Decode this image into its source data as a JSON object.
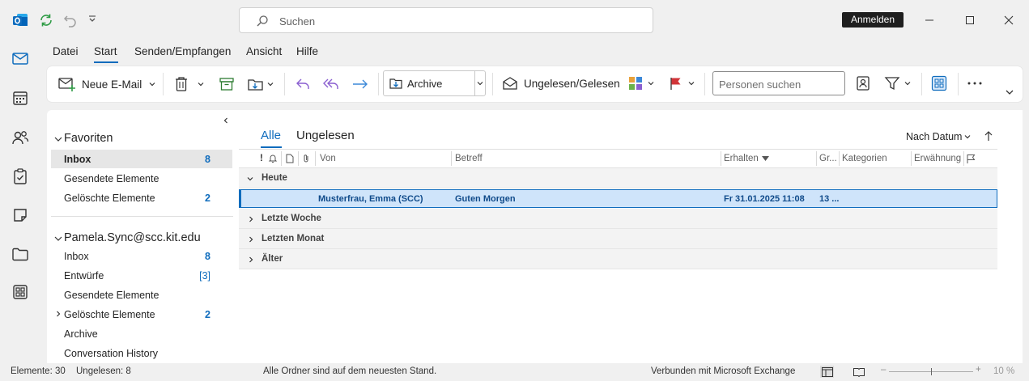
{
  "titlebar": {
    "search_placeholder": "Suchen",
    "signin_label": "Anmelden"
  },
  "menu": {
    "items": [
      "Datei",
      "Start",
      "Senden/Empfangen",
      "Ansicht",
      "Hilfe"
    ]
  },
  "ribbon": {
    "new_mail": "Neue E-Mail",
    "archive": "Archive",
    "unread_read": "Ungelesen/Gelesen",
    "persons_placeholder": "Personen suchen"
  },
  "folders": {
    "favorites_header": "Favoriten",
    "favorites": [
      {
        "label": "Inbox",
        "count": "8"
      },
      {
        "label": "Gesendete Elemente",
        "count": ""
      },
      {
        "label": "Gelöschte Elemente",
        "count": "2"
      }
    ],
    "account_header": "Pamela.Sync@scc.kit.edu",
    "account_items": [
      {
        "label": "Inbox",
        "count": "8"
      },
      {
        "label": "Entwürfe",
        "count": "[3]"
      },
      {
        "label": "Gesendete Elemente",
        "count": ""
      },
      {
        "label": "Gelöschte Elemente",
        "count": "2"
      },
      {
        "label": "Archive",
        "count": ""
      },
      {
        "label": "Conversation History",
        "count": ""
      }
    ]
  },
  "mail": {
    "tabs": [
      "Alle",
      "Ungelesen"
    ],
    "sort_label": "Nach Datum",
    "columns": {
      "flag": "!",
      "from": "Von",
      "subject": "Betreff",
      "received": "Erhalten",
      "size": "Gr...",
      "categories": "Kategorien",
      "mention": "Erwähnung"
    },
    "groups": [
      "Heute",
      "Letzte Woche",
      "Letzten Monat",
      "Älter"
    ],
    "message": {
      "from": "Musterfrau, Emma (SCC)",
      "subject": "Guten Morgen",
      "received": "Fr 31.01.2025 11:08",
      "size": "13 ..."
    }
  },
  "status": {
    "items": "Elemente: 30",
    "unread": "Ungelesen: 8",
    "sync": "Alle Ordner sind auf dem neuesten Stand.",
    "connection": "Verbunden mit Microsoft Exchange",
    "zoom": "10 %"
  },
  "colors": {
    "accent": "#0f6cbd",
    "selected_row": "#cfe4fa",
    "signin_bg": "#1f1f1f",
    "flag_red": "#d13438"
  },
  "icons": [
    "outlook-logo-icon",
    "sync-icon",
    "undo-icon",
    "customize-icon",
    "search-icon",
    "mail-icon",
    "calendar-icon",
    "people-icon",
    "tasks-icon",
    "notes-icon",
    "folder-icon",
    "apps-icon",
    "delete-icon",
    "archive-icon",
    "move-icon",
    "reply-icon",
    "reply-all-icon",
    "forward-icon",
    "envelope-open-icon",
    "categorize-icon",
    "flag-icon",
    "contact-card-icon",
    "filter-icon",
    "more-icon"
  ]
}
